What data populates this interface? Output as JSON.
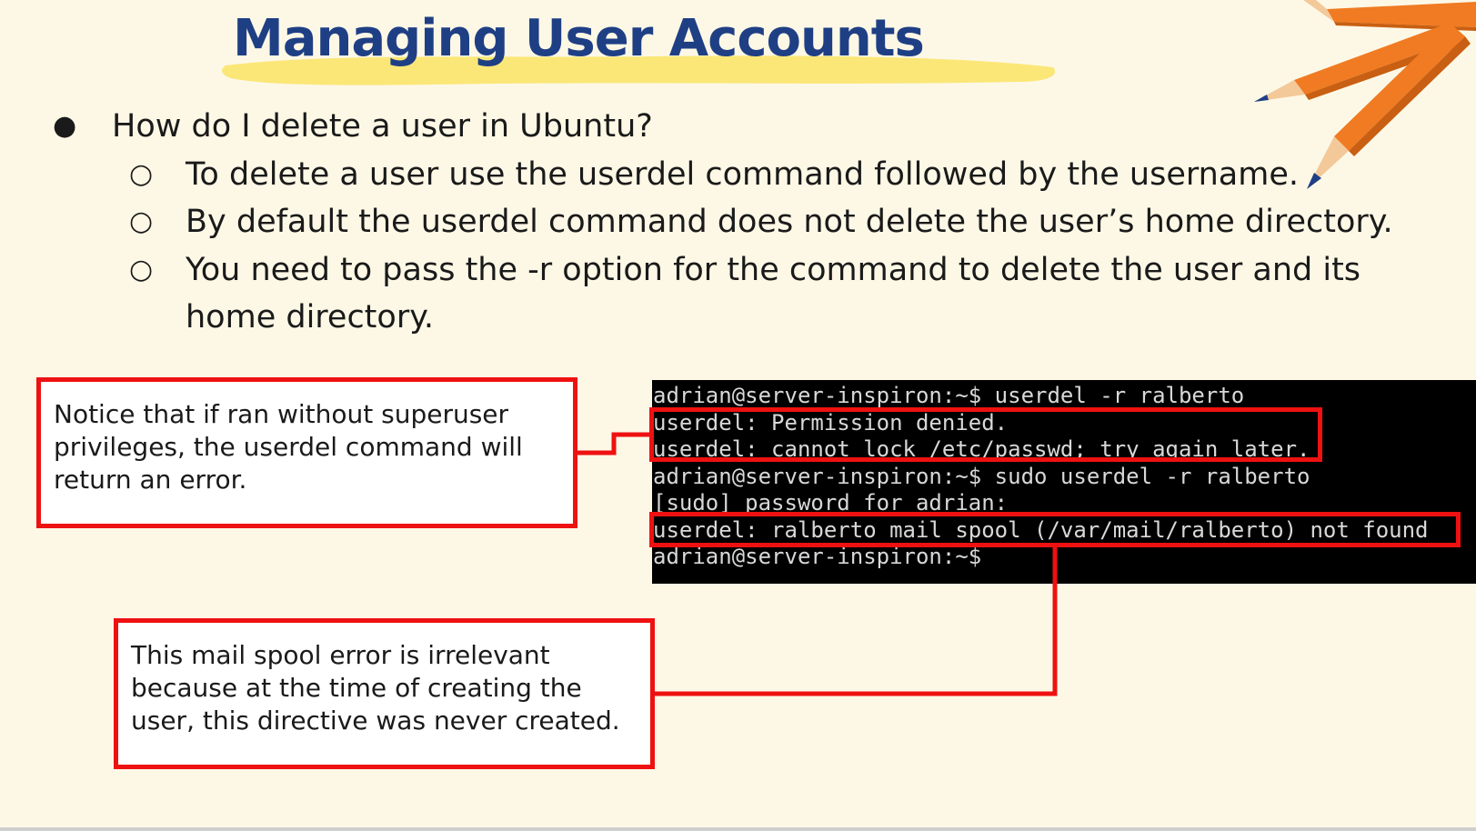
{
  "slide": {
    "title": "Managing User Accounts",
    "bullets": [
      {
        "level": 1,
        "text": "How do I delete a user in Ubuntu?"
      },
      {
        "level": 2,
        "text": "To delete a user use the userdel command followed by the username."
      },
      {
        "level": 2,
        "text": "By default the userdel command does not delete the user’s home directory."
      },
      {
        "level": 2,
        "text": "You need to pass the -r option for the command to delete the user and its"
      },
      {
        "level": 0,
        "text": "home directory."
      }
    ],
    "bullet_symbols": {
      "level1": "●",
      "level2": "○"
    }
  },
  "notes": {
    "superuser": [
      "Notice that if ran without superuser",
      "privileges, the userdel command will",
      "return an error."
    ],
    "mail_spool": [
      "This mail spool error is irrelevant",
      "because at the time of creating  the",
      "user, this directive was never created."
    ]
  },
  "terminal": {
    "lines": [
      "adrian@server-inspiron:~$ userdel -r ralberto",
      "userdel: Permission denied.",
      "userdel: cannot lock /etc/passwd; try again later.",
      "adrian@server-inspiron:~$ sudo userdel -r ralberto",
      "[sudo] password for adrian:",
      "userdel: ralberto mail spool (/var/mail/ralberto) not found",
      "adrian@server-inspiron:~$"
    ]
  },
  "colors": {
    "background": "#fdf8e6",
    "title": "#1f3f85",
    "highlight": "#fbe46a",
    "callout": "#ee1111",
    "pencil": "#f07b22",
    "pencil_tip": "#1f3f85"
  },
  "icons": [
    "pencil-icon",
    "pencil-icon",
    "pencil-icon"
  ]
}
